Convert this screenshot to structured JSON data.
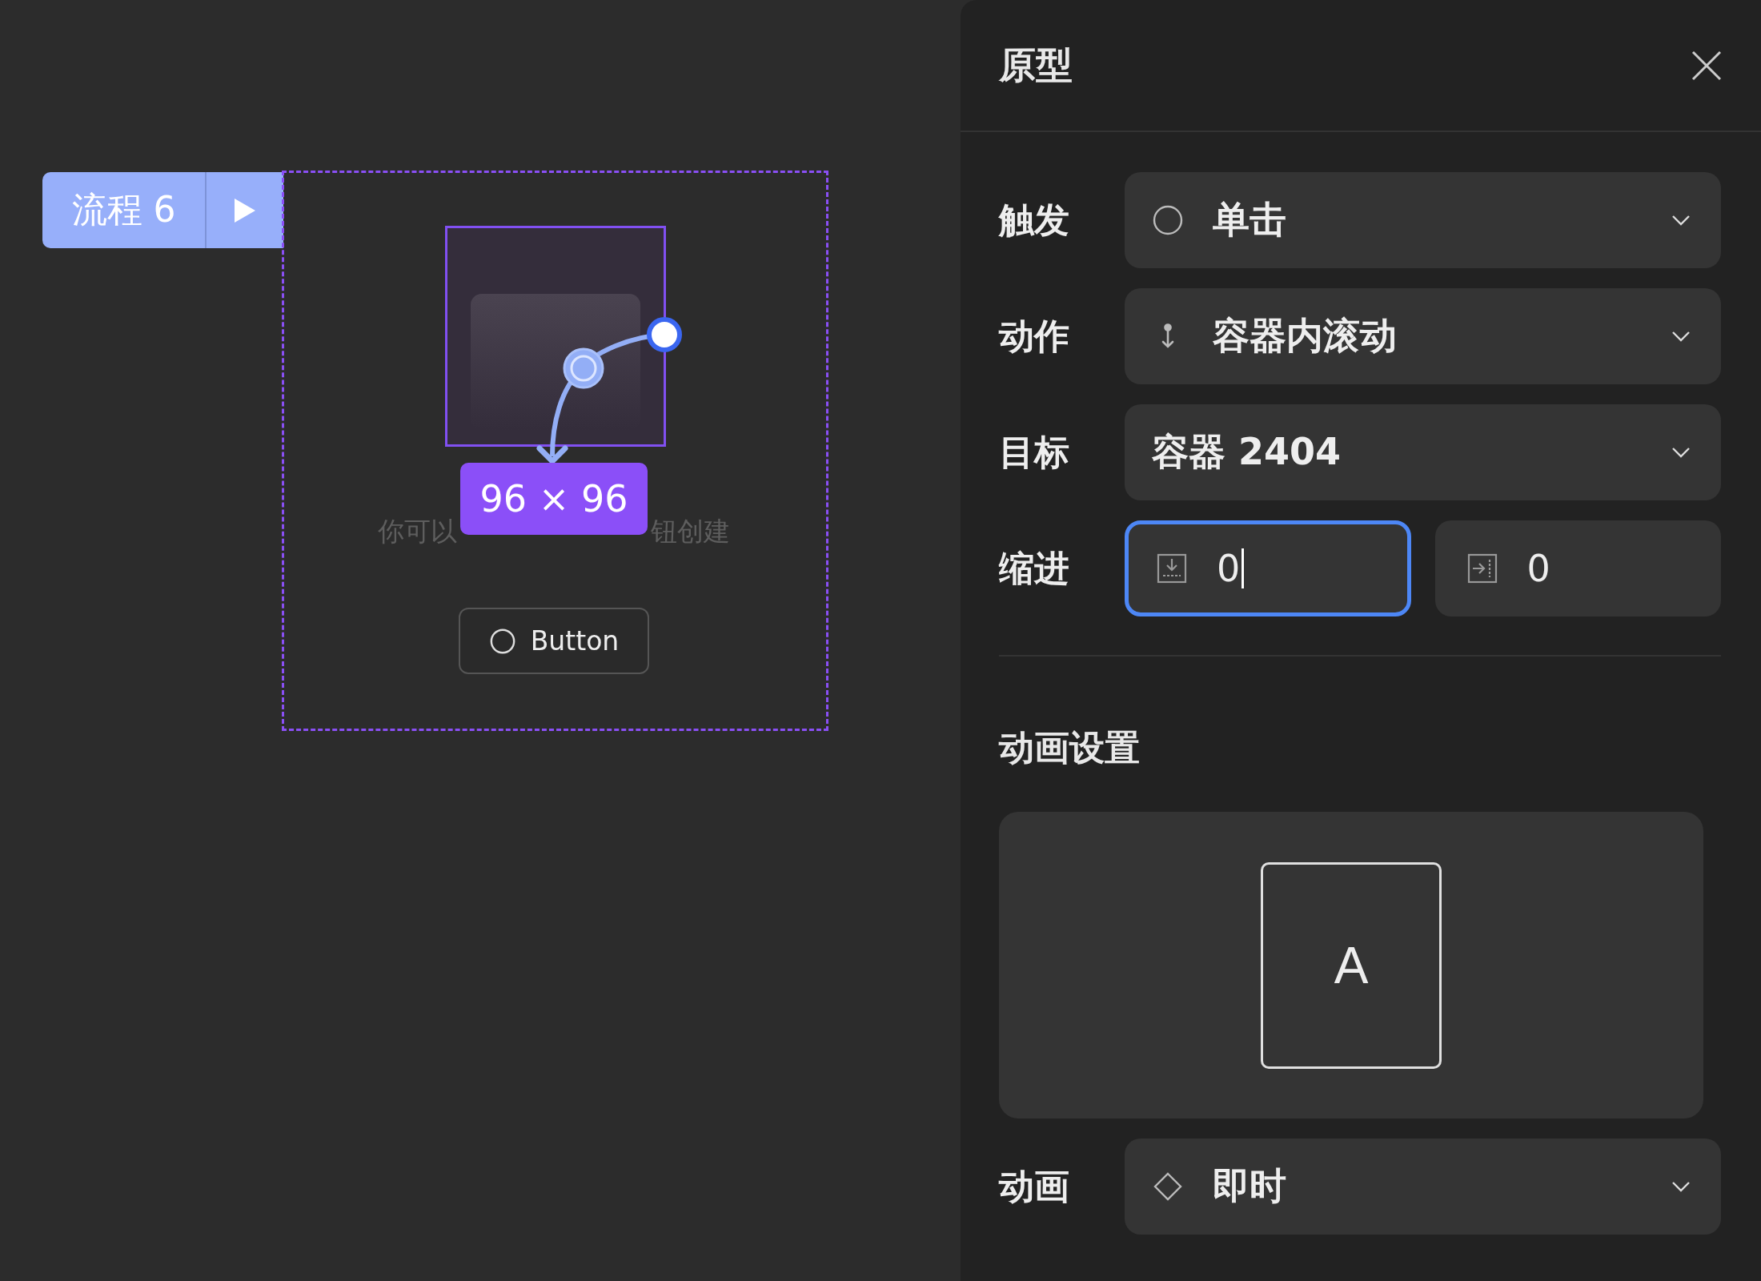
{
  "canvas": {
    "flow": {
      "label": "流程 6"
    },
    "size_badge": "96 × 96",
    "hint": [
      "你可以",
      "钮创建"
    ],
    "button": {
      "label": "Button"
    }
  },
  "panel": {
    "title": "原型",
    "fields": [
      {
        "kind": "select",
        "label": "触发",
        "value": "单击"
      },
      {
        "kind": "select",
        "label": "动作",
        "value": "容器内滚动"
      },
      {
        "kind": "select",
        "label": "目标",
        "value": "容器 2404"
      },
      {
        "kind": "pair",
        "label": "缩进",
        "inputs": [
          {
            "value": "0",
            "focused": true
          },
          {
            "value": "0",
            "focused": false
          }
        ]
      }
    ],
    "animation": {
      "title": "动画设置",
      "preview": "A",
      "field": {
        "kind": "select",
        "label": "动画",
        "value": "即时"
      }
    }
  }
}
